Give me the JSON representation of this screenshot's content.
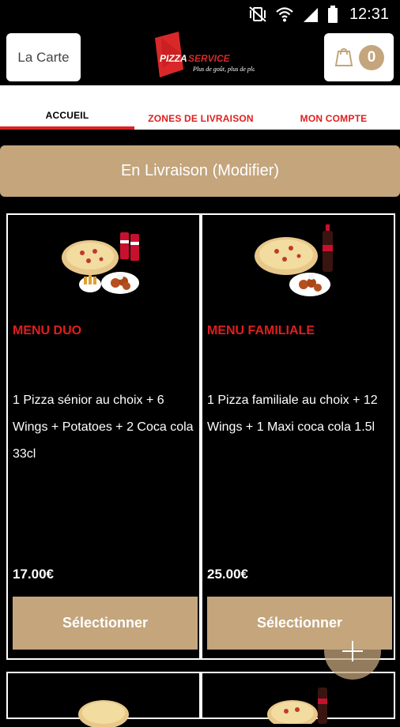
{
  "status_bar": {
    "time": "12:31",
    "icons": [
      "vibrate-off-icon",
      "wifi-icon",
      "signal-icon",
      "battery-icon"
    ]
  },
  "header": {
    "menu_button_label": "La Carte",
    "logo_text": "PIZZASERVICE",
    "logo_tagline": "Plus de goût, plus de plaisir!",
    "cart_count": "0"
  },
  "tabs": [
    {
      "label": "ACCUEIL",
      "active": true
    },
    {
      "label": "ZONES DE LIVRAISON",
      "active": false
    },
    {
      "label": "MON COMPTE",
      "active": false
    }
  ],
  "delivery_mode_label": "En Livraison (Modifier)",
  "products": [
    {
      "title": "MENU DUO",
      "description": "1 Pizza sénior au choix + 6 Wings + Potatoes + 2 Coca cola 33cl",
      "price": "17.00€",
      "button_label": "Sélectionner"
    },
    {
      "title": "MENU FAMILIALE",
      "description": "1 Pizza familiale au choix + 12 Wings + 1 Maxi coca cola 1.5l",
      "price": "25.00€",
      "button_label": "Sélectionner"
    }
  ],
  "colors": {
    "accent": "#c4a57c",
    "title_red": "#e01e1e",
    "background": "#000000",
    "card_border": "#ffffff"
  }
}
